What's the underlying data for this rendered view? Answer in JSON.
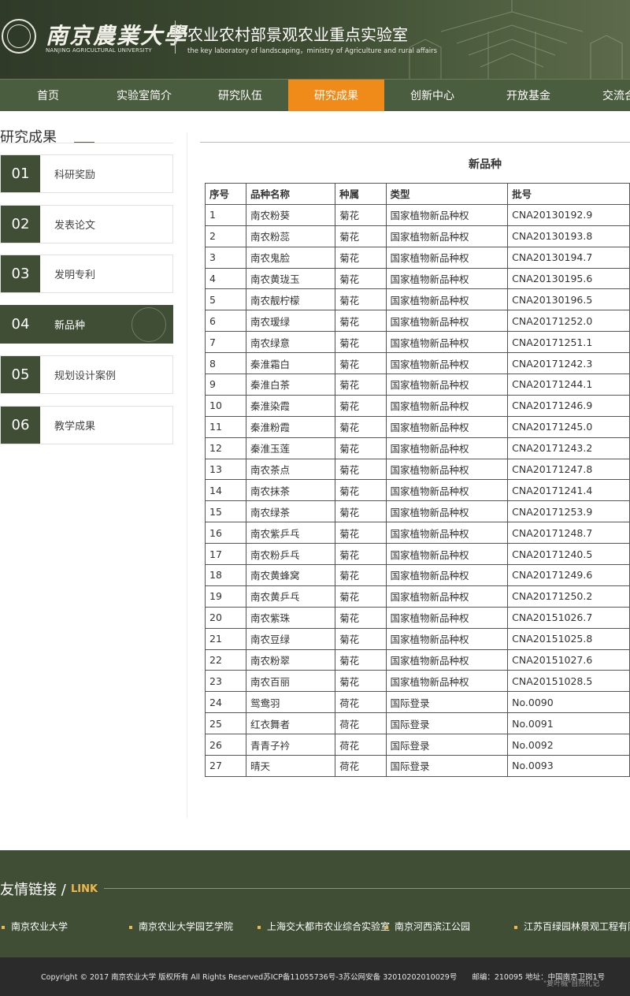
{
  "header": {
    "university_cn": "南京農業大學",
    "university_en": "NANJING AGRICULTURAL UNIVERSITY",
    "lab_cn": "农业农村部景观农业重点实验室",
    "lab_en": "the key laboratory of landscaping，ministry of Agriculture and rural affairs"
  },
  "nav": {
    "items": [
      "首页",
      "实验室简介",
      "研究队伍",
      "研究成果",
      "创新中心",
      "开放基金",
      "交流合作"
    ],
    "active_index": 3
  },
  "sidebar": {
    "title": "研究成果",
    "items": [
      {
        "num": "01",
        "label": "科研奖励"
      },
      {
        "num": "02",
        "label": "发表论文"
      },
      {
        "num": "03",
        "label": "发明专利"
      },
      {
        "num": "04",
        "label": "新品种"
      },
      {
        "num": "05",
        "label": "规划设计案例"
      },
      {
        "num": "06",
        "label": "教学成果"
      }
    ],
    "active_index": 3
  },
  "content": {
    "title": "新品种",
    "columns": [
      "序号",
      "品种名称",
      "种属",
      "类型",
      "批号"
    ],
    "rows": [
      [
        "1",
        "南农粉葵",
        "菊花",
        "国家植物新品种权",
        "CNA20130192.9"
      ],
      [
        "2",
        "南农粉蕊",
        "菊花",
        "国家植物新品种权",
        "CNA20130193.8"
      ],
      [
        "3",
        "南农鬼脸",
        "菊花",
        "国家植物新品种权",
        "CNA20130194.7"
      ],
      [
        "4",
        "南农黄珑玉",
        "菊花",
        "国家植物新品种权",
        "CNA20130195.6"
      ],
      [
        "5",
        "南农靓柠檬",
        "菊花",
        "国家植物新品种权",
        "CNA20130196.5"
      ],
      [
        "6",
        "南农瑷绿",
        "菊花",
        "国家植物新品种权",
        "CNA20171252.0"
      ],
      [
        "7",
        "南农绿意",
        "菊花",
        "国家植物新品种权",
        "CNA20171251.1"
      ],
      [
        "8",
        "秦淮霜白",
        "菊花",
        "国家植物新品种权",
        "CNA20171242.3"
      ],
      [
        "9",
        "秦淮白茶",
        "菊花",
        "国家植物新品种权",
        "CNA20171244.1"
      ],
      [
        "10",
        "秦淮染霞",
        "菊花",
        "国家植物新品种权",
        "CNA20171246.9"
      ],
      [
        "11",
        "秦淮粉霞",
        "菊花",
        "国家植物新品种权",
        "CNA20171245.0"
      ],
      [
        "12",
        "秦淮玉莲",
        "菊花",
        "国家植物新品种权",
        "CNA20171243.2"
      ],
      [
        "13",
        "南农茶点",
        "菊花",
        "国家植物新品种权",
        "CNA20171247.8"
      ],
      [
        "14",
        "南农抹茶",
        "菊花",
        "国家植物新品种权",
        "CNA20171241.4"
      ],
      [
        "15",
        "南农绿茶",
        "菊花",
        "国家植物新品种权",
        "CNA20171253.9"
      ],
      [
        "16",
        "南农紫乒乓",
        "菊花",
        "国家植物新品种权",
        "CNA20171248.7"
      ],
      [
        "17",
        "南农粉乒乓",
        "菊花",
        "国家植物新品种权",
        "CNA20171240.5"
      ],
      [
        "18",
        "南农黄蜂窝",
        "菊花",
        "国家植物新品种权",
        "CNA20171249.6"
      ],
      [
        "19",
        "南农黄乒乓",
        "菊花",
        "国家植物新品种权",
        "CNA20171250.2"
      ],
      [
        "20",
        "南农紫珠",
        "菊花",
        "国家植物新品种权",
        "CNA20151026.7"
      ],
      [
        "21",
        "南农豆绿",
        "菊花",
        "国家植物新品种权",
        "CNA20151025.8"
      ],
      [
        "22",
        "南农粉翠",
        "菊花",
        "国家植物新品种权",
        "CNA20151027.6"
      ],
      [
        "23",
        "南农百丽",
        "菊花",
        "国家植物新品种权",
        "CNA20151028.5"
      ],
      [
        "24",
        "鸳鸯羽",
        "荷花",
        "国际登录",
        "No.0090"
      ],
      [
        "25",
        "红衣舞者",
        "荷花",
        "国际登录",
        "No.0091"
      ],
      [
        "26",
        "青青子衿",
        "荷花",
        "国际登录",
        "No.0092"
      ],
      [
        "27",
        "晴天",
        "荷花",
        "国际登录",
        "No.0093"
      ]
    ]
  },
  "footer": {
    "links_title": "友情链接 /",
    "links_subtitle": "LINK",
    "links": [
      "南京农业大学",
      "南京农业大学园艺学院",
      "上海交大都市农业综合实验室",
      "南京河西滨江公园",
      "江苏百绿园林景观工程有限公司"
    ],
    "copyright": "Copyright © 2017 南京农业大学 版权所有 All Rights Reserved苏ICP备11055736号-3苏公网安备 32010202010029号　　邮编：210095 地址：中国南京卫岗1号",
    "watermark": "\"复叶槭\"自然札记"
  },
  "colors": {
    "header_bg": "#3c4a31",
    "nav_bg": "#4b5d3f",
    "nav_active": "#f08a18",
    "sidebar_num_bg": "#3f4e35",
    "footer_bg": "#3f4e35",
    "copyright_bg": "#2b2b2b",
    "link_accent": "#f0b84a"
  }
}
